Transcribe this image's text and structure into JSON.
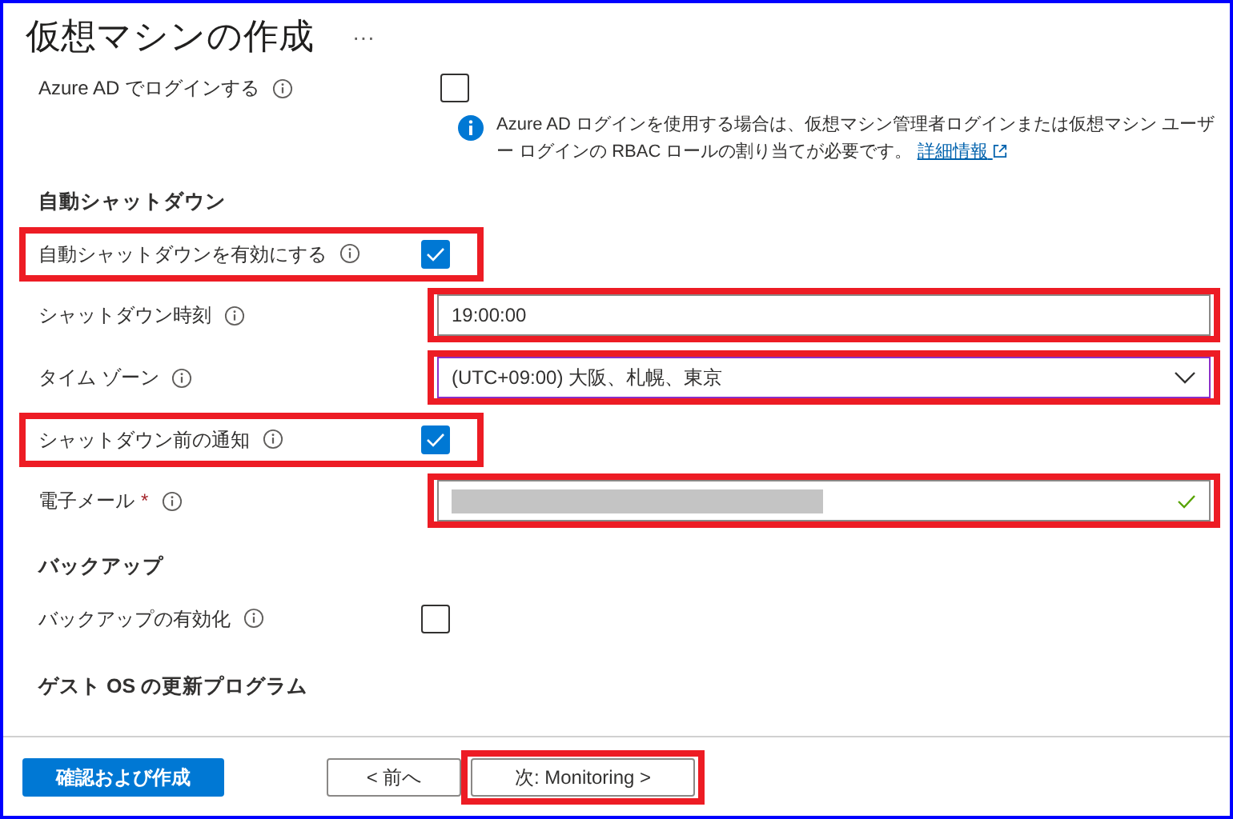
{
  "page": {
    "title": "仮想マシンの作成",
    "more": "···"
  },
  "top_row": {
    "label": "Azure AD でログインする",
    "checked": false
  },
  "info": {
    "text": "Azure AD ログインを使用する場合は、仮想マシン管理者ログインまたは仮想マシン ユーザー ログインの RBAC ロールの割り当てが必要です。",
    "link": "詳細情報"
  },
  "sections": [
    {
      "heading": "自動シャットダウン",
      "fields": [
        {
          "kind": "checkbox",
          "label": "自動シャットダウンを有効にする",
          "checked": true,
          "highlight": true
        },
        {
          "kind": "text",
          "label": "シャットダウン時刻",
          "value": "19:00:00",
          "highlight": true
        },
        {
          "kind": "select",
          "label": "タイム ゾーン",
          "value": "(UTC+09:00) 大阪、札幌、東京",
          "focused": true,
          "highlight": true
        },
        {
          "kind": "checkbox",
          "label": "シャットダウン前の通知",
          "checked": true,
          "highlight": true
        },
        {
          "kind": "redacted",
          "label": "電子メール",
          "required_mark": "*",
          "valid": true,
          "highlight": true
        }
      ]
    },
    {
      "heading": "バックアップ",
      "fields": [
        {
          "kind": "checkbox",
          "label": "バックアップの有効化",
          "checked": false,
          "highlight": false
        }
      ]
    }
  ],
  "cut_heading": "ゲスト OS の更新プログラム",
  "footer": {
    "buttons": [
      {
        "label": "確認および作成",
        "kind": "primary",
        "highlight": false
      },
      {
        "label": "< 前へ",
        "kind": "secondary",
        "highlight": false
      },
      {
        "label": "次: Monitoring >",
        "kind": "secondary",
        "highlight": true
      }
    ]
  }
}
